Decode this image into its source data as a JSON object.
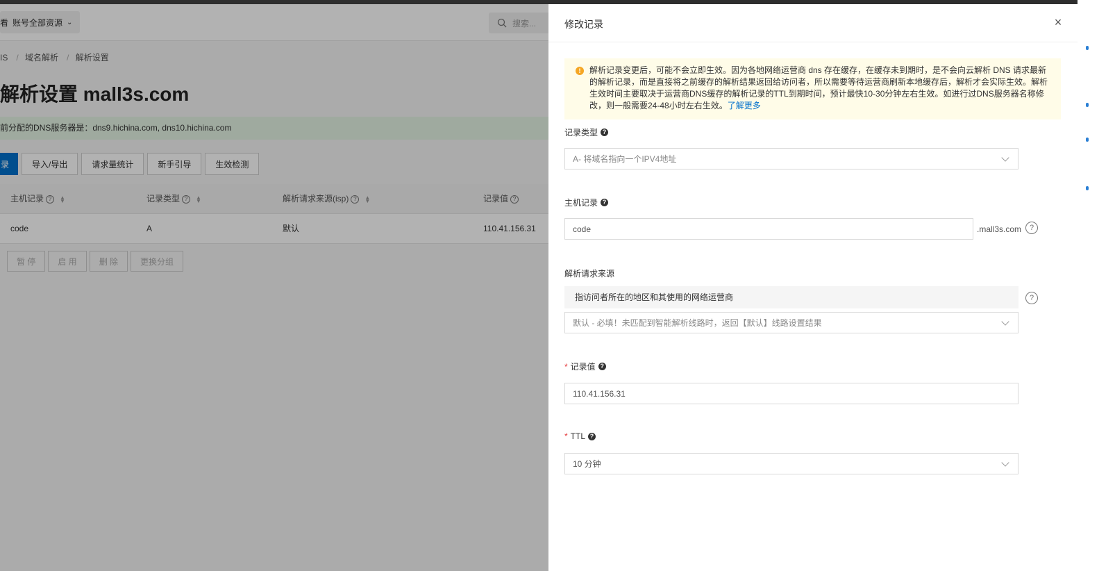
{
  "background": {
    "account_label": "账号全部资源",
    "account_prefix": "看",
    "search_placeholder": "搜索...",
    "breadcrumb": [
      "IS",
      "域名解析",
      "解析设置"
    ],
    "page_title": "解析设置 mall3s.com",
    "dns_notice": "前分配的DNS服务器是：dns9.hichina.com, dns10.hichina.com",
    "toolbar": [
      "录",
      "导入/导出",
      "请求量统计",
      "新手引导",
      "生效检测"
    ],
    "table": {
      "headers": [
        "主机记录",
        "记录类型",
        "解析请求来源(isp)",
        "记录值"
      ],
      "rows": [
        [
          "code",
          "A",
          "默认",
          "110.41.156.31"
        ]
      ]
    },
    "batch_actions": [
      "暂 停",
      "启 用",
      "删 除",
      "更换分组"
    ]
  },
  "drawer": {
    "title": "修改记录",
    "notice_text": "解析记录变更后，可能不会立即生效。因为各地网络运营商 dns 存在缓存，在缓存未到期时，是不会向云解析 DNS 请求最新的解析记录，而是直接将之前缓存的解析结果返回给访问者，所以需要等待运营商刷新本地缓存后，解析才会实际生效。解析生效时间主要取决于运营商DNS缓存的解析记录的TTL到期时间，预计最快10-30分钟左右生效。如进行过DNS服务器名称修改，则一般需要24-48小时左右生效。",
    "notice_link": "了解更多",
    "record_type": {
      "label": "记录类型",
      "value": "A- 将域名指向一个IPV4地址"
    },
    "host_record": {
      "label": "主机记录",
      "value": "code",
      "suffix": ".mall3s.com"
    },
    "isp": {
      "label": "解析请求来源",
      "hint": "指访问者所在的地区和其使用的网络运营商",
      "value": "默认 - 必填！未匹配到智能解析线路时，返回【默认】线路设置结果"
    },
    "record_value": {
      "label": "记录值",
      "value": "110.41.156.31"
    },
    "ttl": {
      "label": "TTL",
      "value": "10 分钟"
    }
  }
}
